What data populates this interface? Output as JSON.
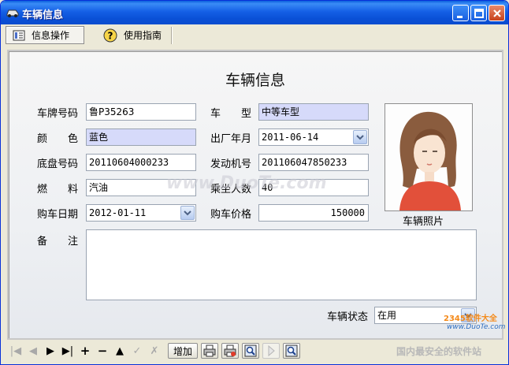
{
  "window": {
    "title": "车辆信息"
  },
  "toolbar": {
    "tab_info": "信息操作",
    "tab_guide": "使用指南"
  },
  "form": {
    "title": "车辆信息",
    "plate_label": "车牌号码",
    "plate_value": "鲁P35263",
    "type_label": "车　　型",
    "type_value": "中等车型",
    "color_label": "颜　　色",
    "color_value": "蓝色",
    "mfg_label": "出厂年月",
    "mfg_value": "2011-06-14",
    "chassis_label": "底盘号码",
    "chassis_value": "20110604000233",
    "engine_label": "发动机号",
    "engine_value": "201106047850233",
    "fuel_label": "燃　　料",
    "fuel_value": "汽油",
    "seats_label": "乘坐人数",
    "seats_value": "40",
    "buy_date_label": "购车日期",
    "buy_date_value": "2012-01-11",
    "price_label": "购车价格",
    "price_value": "150000",
    "memo_label": "备　　注",
    "memo_value": "",
    "photo_label": "车辆照片",
    "status_label": "车辆状态",
    "status_value": "在用"
  },
  "navbar": {
    "add_label": "增加"
  },
  "watermark": {
    "text": "www.DuoTe.com",
    "brand": "2345软件大全",
    "url": "www.DuoTe.com",
    "slogan": "国内最安全的软件站"
  },
  "icons": [
    "car-icon",
    "minimize-icon",
    "maximize-icon",
    "close-icon",
    "form-icon",
    "help-icon",
    "first-icon",
    "prev-icon",
    "next-icon",
    "last-icon",
    "add-icon",
    "delete-icon",
    "up-icon",
    "save-icon",
    "cancel-icon",
    "print-icon",
    "print-preview-icon",
    "search-icon",
    "play-icon",
    "find-icon"
  ],
  "colors": {
    "highlight_field": "#d6dafa",
    "title_bar": "#0a50d6"
  }
}
